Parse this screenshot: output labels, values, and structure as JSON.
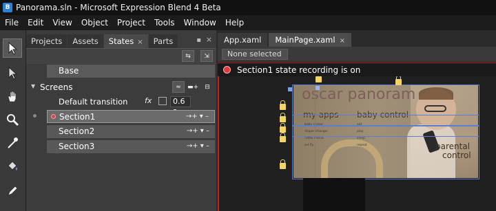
{
  "window": {
    "title": "Panorama.sln - Microsoft Expression Blend 4 Beta",
    "app_icon": "expression-blend-icon"
  },
  "menu": [
    "File",
    "Edit",
    "View",
    "Object",
    "Project",
    "Tools",
    "Window",
    "Help"
  ],
  "toolbox": [
    {
      "icon": "selection-arrow-icon",
      "active": true
    },
    {
      "icon": "direct-selection-icon",
      "active": false
    },
    {
      "icon": "pan-hand-icon",
      "active": false
    },
    {
      "icon": "zoom-icon",
      "active": false
    },
    {
      "icon": "eyedropper-icon",
      "active": false
    },
    {
      "icon": "paint-bucket-icon",
      "active": false
    },
    {
      "icon": "pen-icon",
      "active": false
    }
  ],
  "panel": {
    "tabs": [
      {
        "label": "Projects",
        "active": false
      },
      {
        "label": "Assets",
        "active": false
      },
      {
        "label": "States",
        "active": true,
        "close": "×"
      },
      {
        "label": "Parts",
        "active": false
      }
    ],
    "pin": "▪",
    "close": "×",
    "base_label": "Base",
    "group": {
      "label": "Screens",
      "default_transition_label": "Default transition",
      "fx": "fx",
      "duration": "0.6 s"
    },
    "states": [
      {
        "label": "Section1",
        "selected": true,
        "recording": true,
        "actions": "→+ ▾ –"
      },
      {
        "label": "Section2",
        "selected": false,
        "recording": false,
        "actions": "→+ ▾ –"
      },
      {
        "label": "Section3",
        "selected": false,
        "recording": false,
        "actions": "→+ ▾ –"
      }
    ]
  },
  "document": {
    "tabs": [
      {
        "label": "App.xaml",
        "active": false
      },
      {
        "label": "MainPage.xaml",
        "active": true,
        "close": "×"
      }
    ],
    "selection": "None selected",
    "recording": "Section1 state recording is on",
    "recording_color": "#e23a3a",
    "artboard": {
      "title": "oscar panoram",
      "col1": "my apps",
      "col2": "baby control",
      "col3_line1": "parental",
      "col3_line2": "control",
      "small_rows": [
        [
          "baby clicker",
          "eat"
        ],
        [
          "diaper changer",
          "play"
        ],
        [
          "rattle mania",
          "sleep"
        ],
        [
          "art fly",
          "repeat"
        ]
      ]
    }
  }
}
